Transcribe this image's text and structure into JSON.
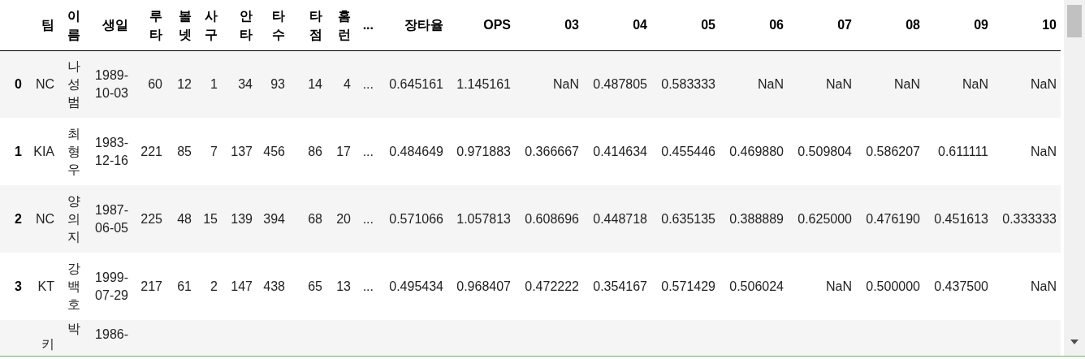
{
  "table": {
    "columns": [
      "팀",
      "이름",
      "생일",
      "루타",
      "볼넷",
      "사구",
      "안타",
      "타수",
      "타점",
      "홈런",
      "...",
      "장타율",
      "OPS",
      "03",
      "04",
      "05",
      "06",
      "07",
      "08",
      "09",
      "10"
    ],
    "rows": [
      {
        "index": "0",
        "cells": [
          "NC",
          "나성범",
          "1989-10-03",
          "60",
          "12",
          "1",
          "34",
          "93",
          "14",
          "4",
          "...",
          "0.645161",
          "1.145161",
          "NaN",
          "0.487805",
          "0.583333",
          "NaN",
          "NaN",
          "NaN",
          "NaN",
          "NaN"
        ]
      },
      {
        "index": "1",
        "cells": [
          "KIA",
          "최형우",
          "1983-12-16",
          "221",
          "85",
          "7",
          "137",
          "456",
          "86",
          "17",
          "...",
          "0.484649",
          "0.971883",
          "0.366667",
          "0.414634",
          "0.455446",
          "0.469880",
          "0.509804",
          "0.586207",
          "0.611111",
          "NaN"
        ]
      },
      {
        "index": "2",
        "cells": [
          "NC",
          "양의지",
          "1987-06-05",
          "225",
          "48",
          "15",
          "139",
          "394",
          "68",
          "20",
          "...",
          "0.571066",
          "1.057813",
          "0.608696",
          "0.448718",
          "0.635135",
          "0.388889",
          "0.625000",
          "0.476190",
          "0.451613",
          "0.333333"
        ]
      },
      {
        "index": "3",
        "cells": [
          "KT",
          "강백호",
          "1999-07-29",
          "217",
          "61",
          "2",
          "147",
          "438",
          "65",
          "13",
          "...",
          "0.495434",
          "0.968407",
          "0.472222",
          "0.354167",
          "0.571429",
          "0.506024",
          "NaN",
          "0.500000",
          "0.437500",
          "NaN"
        ]
      },
      {
        "kind": "cut",
        "cells": [
          "키",
          "박",
          "1986-"
        ]
      }
    ]
  }
}
